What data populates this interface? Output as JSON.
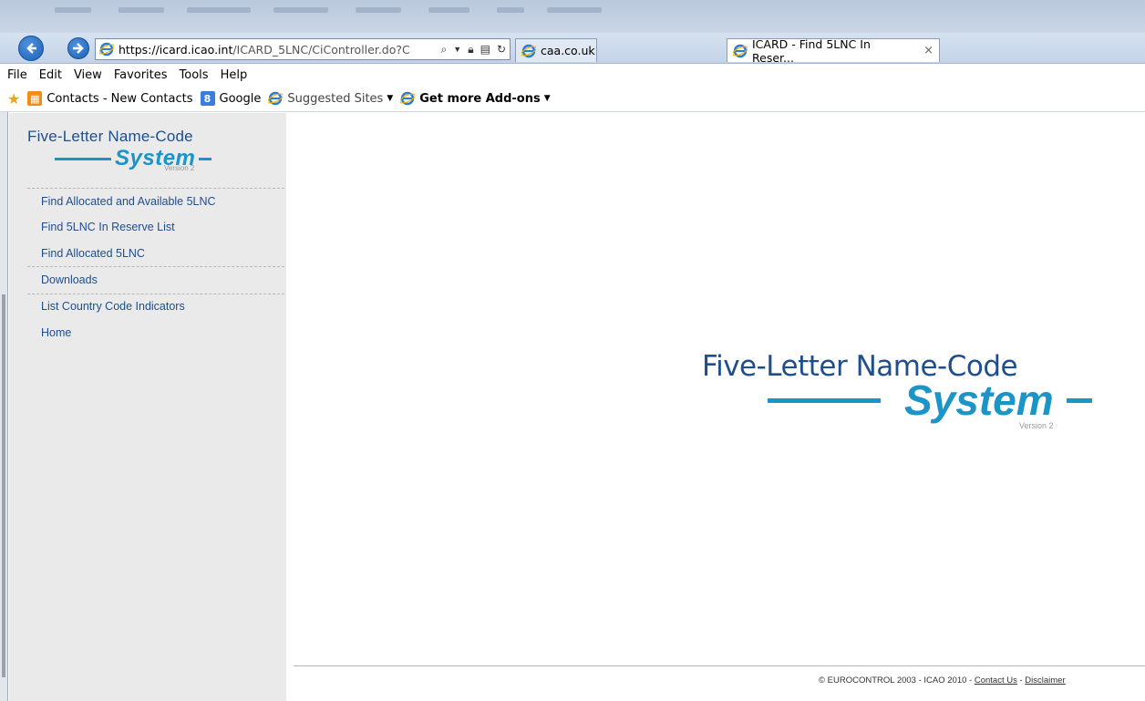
{
  "browser": {
    "address_url_host": "https://icard.icao.int",
    "address_url_rest": "/ICARD_5LNC/CiController.do?C",
    "tabs": [
      {
        "label": "caa.co.uk"
      },
      {
        "label": "ICARD - Find 5LNC In Reser...",
        "close": "×"
      }
    ],
    "menu": [
      "File",
      "Edit",
      "View",
      "Favorites",
      "Tools",
      "Help"
    ],
    "favorites": {
      "contacts": "Contacts - New Contacts",
      "google": "Google",
      "suggested": "Suggested Sites",
      "addons": "Get more Add-ons"
    }
  },
  "sidebar": {
    "logo": {
      "line1": "Five-Letter Name-Code",
      "system": "System",
      "version": "Version 2"
    },
    "links": [
      "Find Allocated and Available 5LNC",
      "Find 5LNC In Reserve List",
      "Find Allocated 5LNC",
      "Downloads",
      "List Country Code Indicators",
      "Home"
    ]
  },
  "main": {
    "logo": {
      "line1": "Five-Letter Name-Code",
      "system": "System",
      "version": "Version 2"
    }
  },
  "footer": {
    "copyright": "© EUROCONTROL 2003 - ICAO 2010 - ",
    "contact": "Contact Us",
    "sep": " - ",
    "disclaimer": "Disclaimer"
  },
  "colors": {
    "brand_blue": "#1b94c7",
    "link_blue": "#1f4e8c",
    "sidebar_bg": "#eaeaea"
  }
}
